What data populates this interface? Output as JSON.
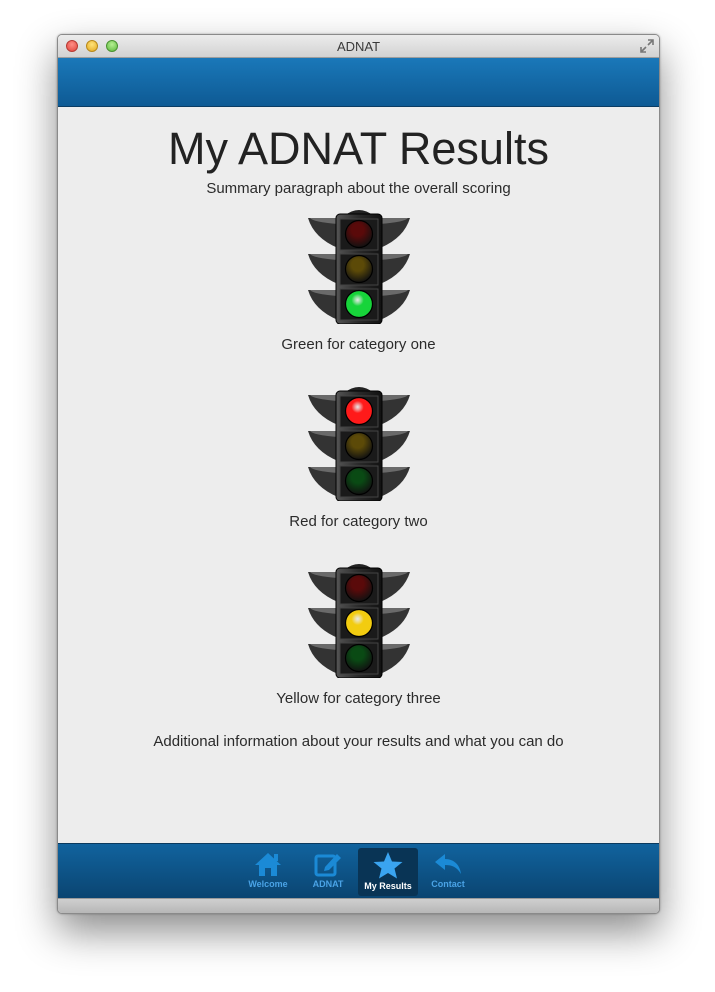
{
  "window": {
    "title": "ADNAT"
  },
  "page": {
    "title": "My ADNAT Results",
    "summary": "Summary paragraph about the overall scoring",
    "additional": "Additional information about your results and what you can do"
  },
  "results": [
    {
      "label": "Green for category one",
      "active_light": "green"
    },
    {
      "label": "Red for category two",
      "active_light": "red"
    },
    {
      "label": "Yellow for category three",
      "active_light": "yellow"
    }
  ],
  "colors": {
    "header_blue": "#1571b0",
    "red_on": "#ff1a1a",
    "red_off": "#5a0a0a",
    "yellow_on": "#f2cc10",
    "yellow_off": "#5c4a08",
    "green_on": "#17d43a",
    "green_off": "#0a4a14"
  },
  "tabs": [
    {
      "label": "Welcome",
      "icon": "home-icon",
      "active": false
    },
    {
      "label": "ADNAT",
      "icon": "edit-icon",
      "active": false
    },
    {
      "label": "My Results",
      "icon": "star-icon",
      "active": true
    },
    {
      "label": "Contact",
      "icon": "reply-icon",
      "active": false
    }
  ]
}
